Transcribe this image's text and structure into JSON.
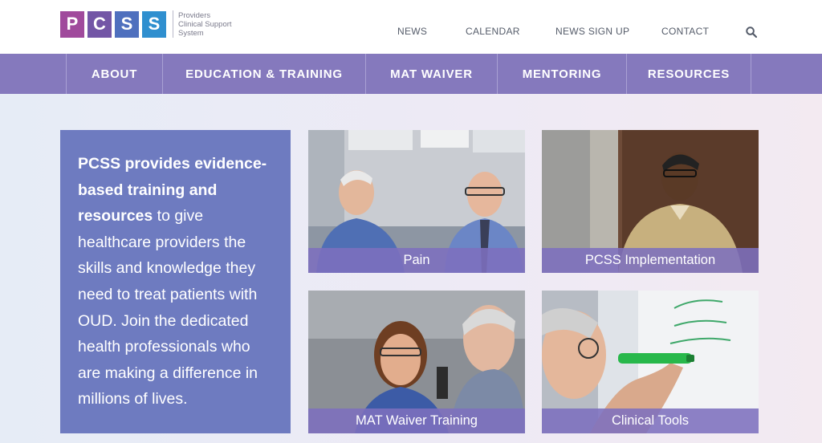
{
  "brand": {
    "logo_letters": [
      "P",
      "C",
      "S",
      "S"
    ],
    "logo_colors": [
      "#a04a9c",
      "#7356a6",
      "#4f70be",
      "#2f8fcf"
    ],
    "tagline_lines": [
      "Providers",
      "Clinical Support",
      "System"
    ]
  },
  "utility_nav": {
    "items": [
      "NEWS",
      "CALENDAR",
      "NEWS SIGN UP",
      "CONTACT"
    ],
    "search_icon": "search-icon"
  },
  "main_nav": {
    "items": [
      "ABOUT",
      "EDUCATION & TRAINING",
      "MAT WAIVER",
      "MENTORING",
      "RESOURCES"
    ]
  },
  "intro": {
    "bold_text": "PCSS provides evidence-based training and resources",
    "rest_text": " to give healthcare providers the skills and knowledge they need to treat patients with OUD. Join the dedicated health professionals who are making a difference in millions of lives."
  },
  "tiles": [
    {
      "label": "Pain"
    },
    {
      "label": "PCSS Implementation"
    },
    {
      "label": "MAT Waiver Training"
    },
    {
      "label": "Clinical Tools"
    }
  ],
  "colors": {
    "nav_bg": "#8579bd",
    "intro_bg": "#6e7bc0",
    "caption_bg": "#7d70be"
  }
}
